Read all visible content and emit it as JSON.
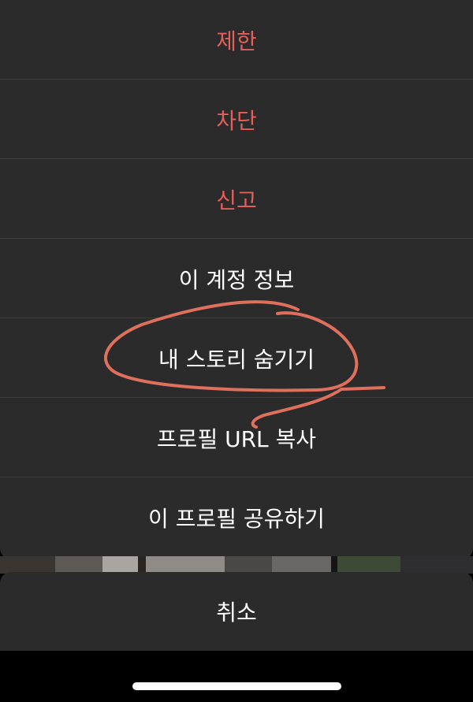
{
  "action_sheet": {
    "items": [
      {
        "label": "제한",
        "style": "destructive"
      },
      {
        "label": "차단",
        "style": "destructive"
      },
      {
        "label": "신고",
        "style": "destructive"
      },
      {
        "label": "이 계정 정보",
        "style": "default"
      },
      {
        "label": "내 스토리 숨기기",
        "style": "default"
      },
      {
        "label": "프로필 URL 복사",
        "style": "default"
      },
      {
        "label": "이 프로필 공유하기",
        "style": "default"
      }
    ],
    "cancel_label": "취소"
  },
  "colors": {
    "destructive": "#e35f5b",
    "default_text": "#ffffff",
    "sheet_background": "#2b2b2b",
    "annotation_stroke": "#e0705e"
  }
}
